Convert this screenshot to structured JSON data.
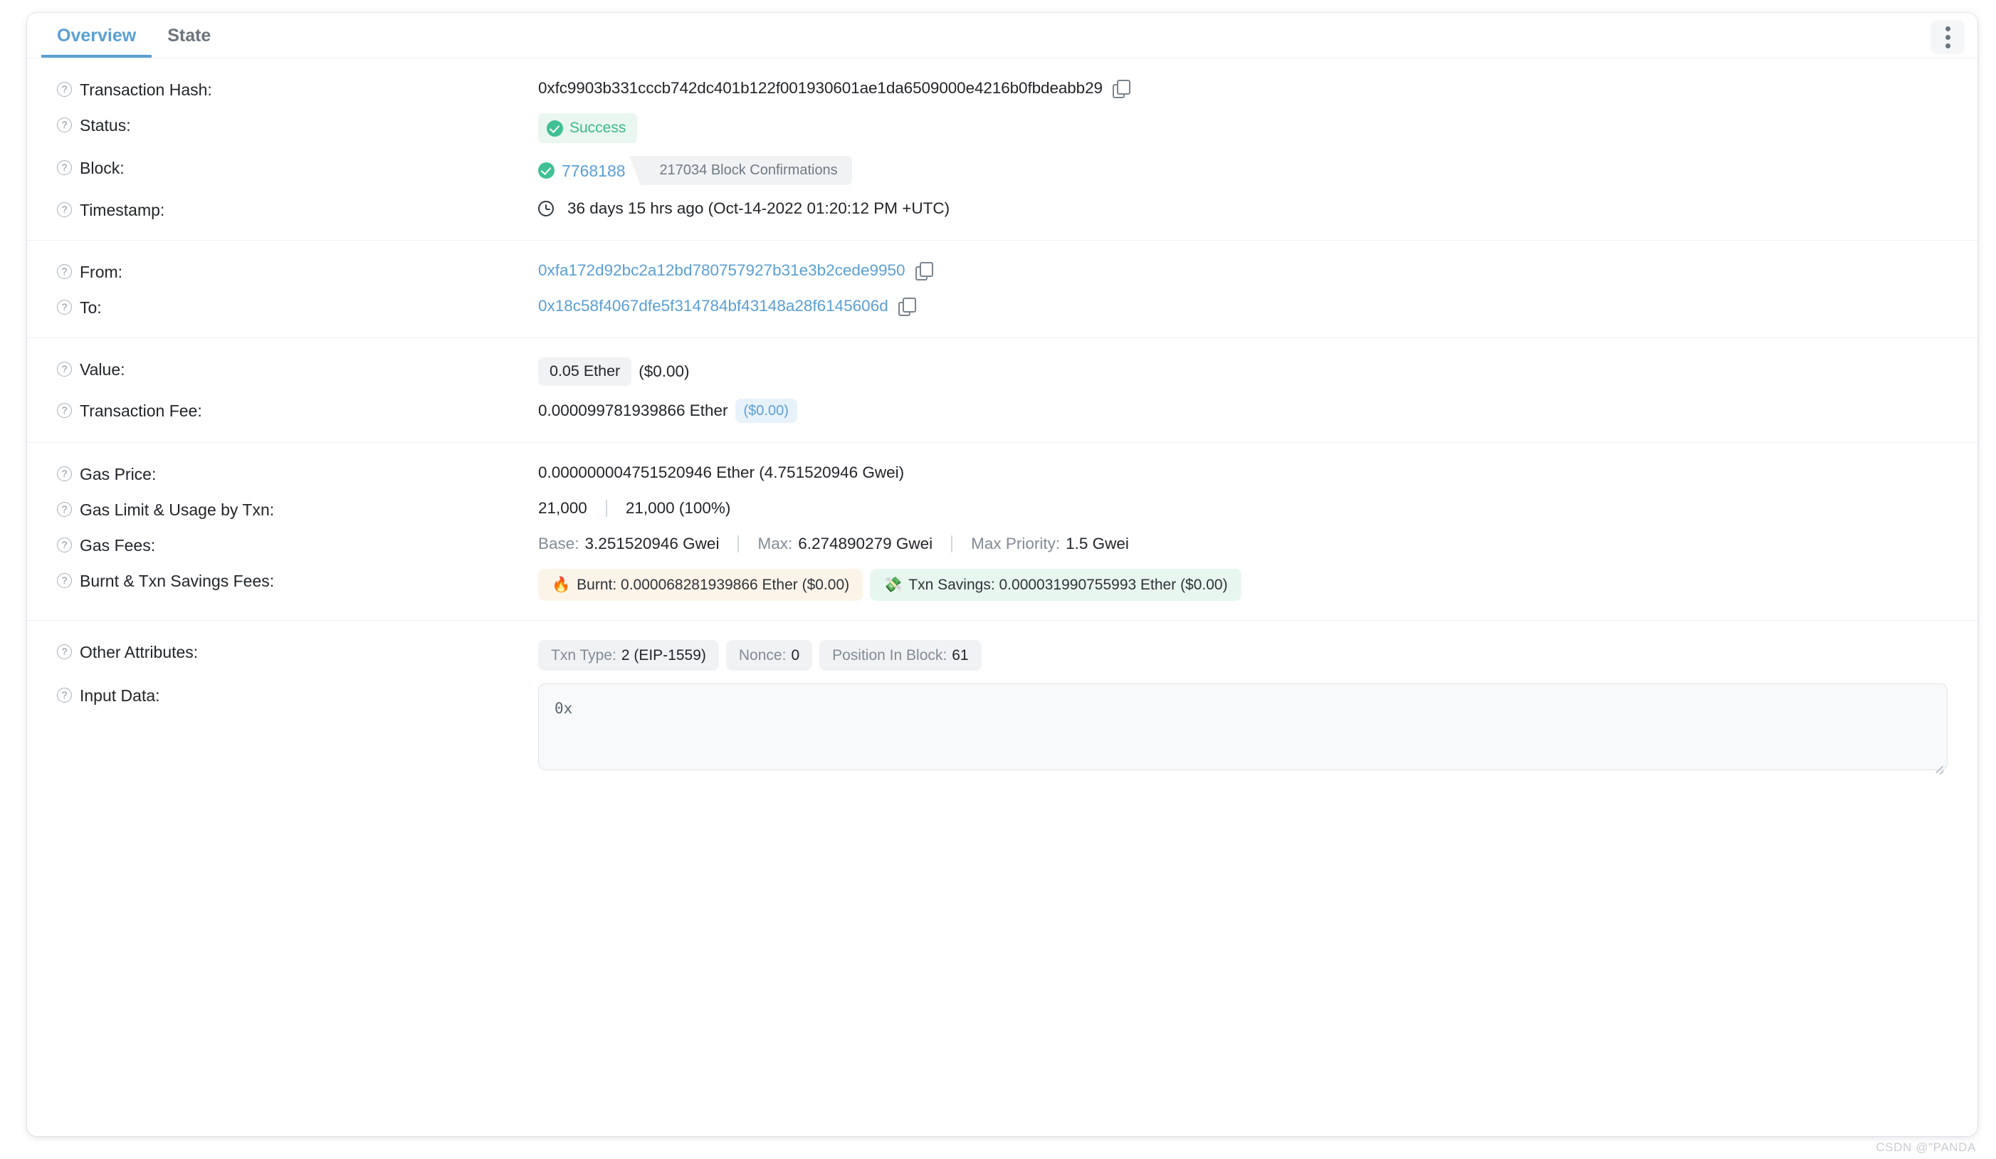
{
  "tabs": [
    {
      "label": "Overview",
      "active": true
    },
    {
      "label": "State",
      "active": false
    }
  ],
  "menu": {
    "icon": "kebab-menu-icon"
  },
  "rows": {
    "transaction_hash": {
      "label": "Transaction Hash:",
      "value": "0xfc9903b331cccb742dc401b122f001930601ae1da6509000e4216b0fbdeabb29"
    },
    "status": {
      "label": "Status:",
      "value": "Success"
    },
    "block": {
      "label": "Block:",
      "number": "7768188",
      "confirmations": "217034 Block Confirmations"
    },
    "timestamp": {
      "label": "Timestamp:",
      "value": "36 days 15 hrs ago (Oct-14-2022 01:20:12 PM +UTC)"
    },
    "from": {
      "label": "From:",
      "value": "0xfa172d92bc2a12bd780757927b31e3b2cede9950"
    },
    "to": {
      "label": "To:",
      "value": "0x18c58f4067dfe5f314784bf43148a28f6145606d"
    },
    "value": {
      "label": "Value:",
      "amount": "0.05 Ether",
      "usd": "($0.00)"
    },
    "transaction_fee": {
      "label": "Transaction Fee:",
      "amount": "0.000099781939866 Ether",
      "usd": "($0.00)"
    },
    "gas_price": {
      "label": "Gas Price:",
      "value": "0.000000004751520946 Ether (4.751520946 Gwei)"
    },
    "gas_limit_usage": {
      "label": "Gas Limit & Usage by Txn:",
      "limit": "21,000",
      "usage": "21,000 (100%)"
    },
    "gas_fees": {
      "label": "Gas Fees:",
      "base_key": "Base:",
      "base_value": "3.251520946 Gwei",
      "max_key": "Max:",
      "max_value": "6.274890279 Gwei",
      "priority_key": "Max Priority:",
      "priority_value": "1.5 Gwei"
    },
    "burnt_savings": {
      "label": "Burnt & Txn Savings Fees:",
      "burnt": "Burnt: 0.000068281939866 Ether ($0.00)",
      "burnt_emoji": "🔥",
      "savings": "Txn Savings: 0.000031990755993 Ether ($0.00)",
      "savings_emoji": "💸"
    },
    "other_attributes": {
      "label": "Other Attributes:",
      "items": [
        {
          "key": "Txn Type:",
          "value": "2 (EIP-1559)"
        },
        {
          "key": "Nonce:",
          "value": "0"
        },
        {
          "key": "Position In Block:",
          "value": "61"
        }
      ]
    },
    "input_data": {
      "label": "Input Data:",
      "value": "0x"
    }
  },
  "icons": {
    "help": "?",
    "copy": "copy-icon",
    "clock": "clock-icon",
    "check": "check-circle-icon"
  },
  "watermark": "CSDN @\"PANDA",
  "colors": {
    "accent_blue": "#5a9fd4",
    "success_green": "#40c094",
    "burnt_bg": "#fcf4e9",
    "savings_bg": "#e8f6f0",
    "pill_gray": "#f1f2f4"
  }
}
